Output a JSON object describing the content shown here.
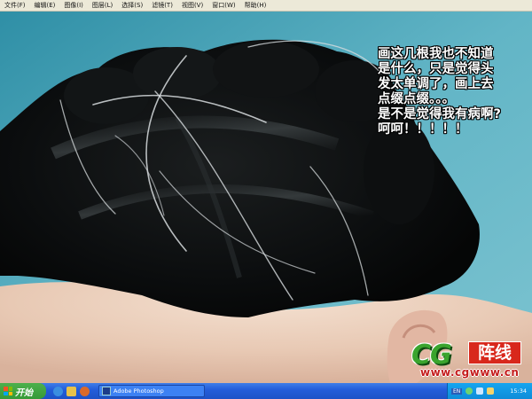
{
  "menu": [
    "文件(F)",
    "编辑(E)",
    "图像(I)",
    "图层(L)",
    "选择(S)",
    "滤镜(T)",
    "视图(V)",
    "窗口(W)",
    "帮助(H)"
  ],
  "annotation_lines": [
    "画这几根我也不知道",
    "是什么，只是觉得头",
    "发太单调了，画上去",
    "点缀点缀。。。",
    "是不是觉得我有病啊?",
    "呵呵！！！！！"
  ],
  "watermark": {
    "cg": "CG",
    "zhenxian": "阵线",
    "url": "www.cgwww.cn"
  },
  "taskbar": {
    "start_label": "开始",
    "task_label": "Adobe Photoshop",
    "lang": "EN",
    "clock": "15:34"
  },
  "colors": {
    "background_teal": "#5fb3c4",
    "hair": "#0a0c0d",
    "taskbar_blue": "#245edb",
    "start_green": "#379a37"
  }
}
